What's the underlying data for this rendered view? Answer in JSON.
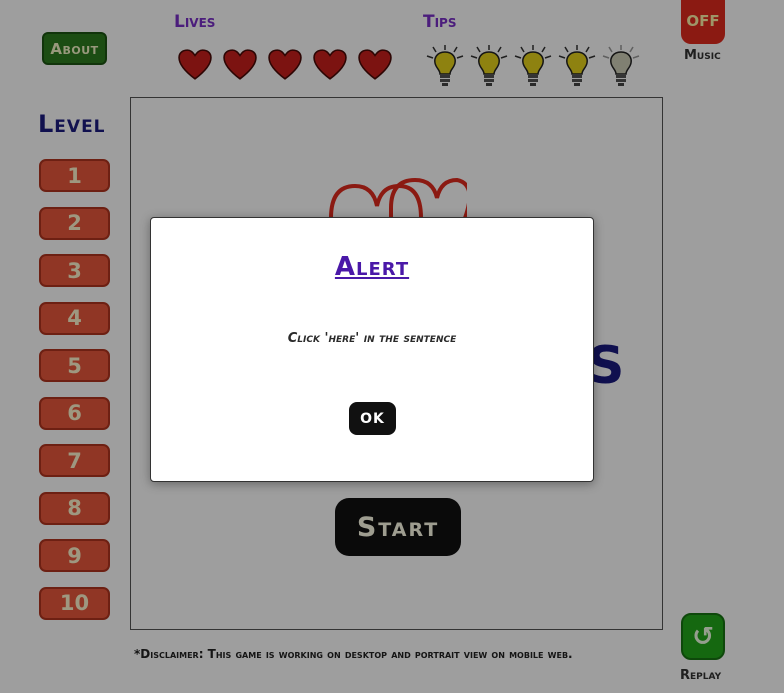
{
  "header": {
    "about_label": "About",
    "lives_label": "Lives",
    "lives_count": 5,
    "tips_label": "Tips",
    "tips_total": 5,
    "tips_available": 4,
    "music_state": "OFF",
    "music_label": "Music"
  },
  "levels": {
    "title": "Level",
    "items": [
      "1",
      "2",
      "3",
      "4",
      "5",
      "6",
      "7",
      "8",
      "9",
      "10"
    ]
  },
  "main": {
    "start_label": "Start",
    "logo_letter": "S"
  },
  "footer": {
    "disclaimer": "*Disclaimer: This game is working on desktop and portrait view on mobile web.",
    "replay_icon": "↺",
    "replay_label": "Replay"
  },
  "alert": {
    "title": "Alert",
    "message": "Click 'here' in the sentence",
    "ok_label": "OK"
  },
  "colors": {
    "heart": "#c8201c",
    "bulb_on": "#e6d21a",
    "bulb_off": "#cfcfb8",
    "level_button": "#e8573c",
    "about_button": "#2e7d1f",
    "replay_button": "#23a81a",
    "music_button": "#e02a1d"
  },
  "icons": {
    "heart": "heart-icon",
    "bulb": "lightbulb-icon",
    "replay": "replay-icon"
  }
}
